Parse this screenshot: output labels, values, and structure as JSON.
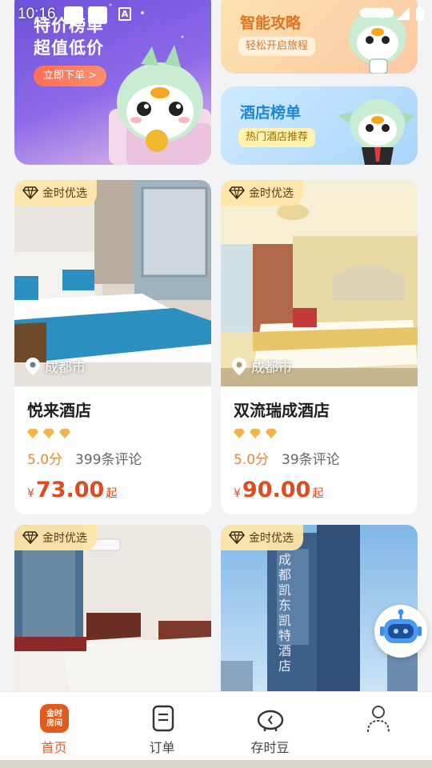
{
  "status_bar": {
    "time": "10:16",
    "a_badge": "A"
  },
  "banners": {
    "big": {
      "line1": "特价榜单",
      "line2": "超值低价",
      "button": "立即下单 >"
    },
    "top_right": {
      "title": "智能攻略",
      "subtitle": "轻松开启旅程"
    },
    "bottom_right": {
      "title": "酒店榜单",
      "subtitle": "热门酒店推荐"
    }
  },
  "hotels": [
    {
      "badge": "金时优选",
      "city": "成都市",
      "name": "悦来酒店",
      "score": "5.0分",
      "reviews": "399条评论",
      "currency": "¥",
      "price": "73.00",
      "suffix": "起"
    },
    {
      "badge": "金时优选",
      "city": "成都市",
      "name": "双流瑞成酒店",
      "score": "5.0分",
      "reviews": "39条评论",
      "currency": "¥",
      "price": "90.00",
      "suffix": "起"
    },
    {
      "badge": "金时优选"
    },
    {
      "badge": "金时优选",
      "sign_text": "成都凯东凯特酒店"
    }
  ],
  "tabbar": [
    {
      "label": "首页",
      "icon": "home-logo-icon",
      "active": true,
      "logo_text_1": "金时",
      "logo_text_2": "房间"
    },
    {
      "label": "订单",
      "icon": "order-icon",
      "active": false
    },
    {
      "label": "存时豆",
      "icon": "piggy-bank-icon",
      "active": false
    },
    {
      "label": "",
      "icon": "profile-icon",
      "active": false
    }
  ],
  "colors": {
    "accent": "#e0622a",
    "price": "#e14a1f",
    "score": "#e48a3c",
    "badge_bg": "#ffe6aa"
  }
}
